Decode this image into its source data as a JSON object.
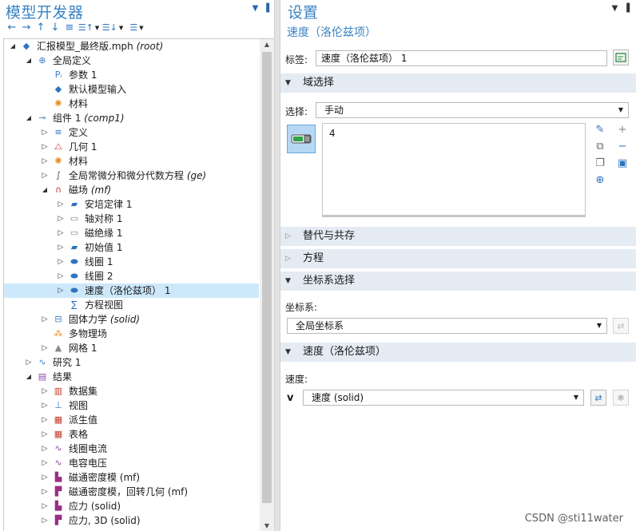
{
  "left_panel": {
    "title": "模型开发器",
    "toolbar_icons": [
      "arrow-left-icon",
      "arrow-right-icon",
      "arrow-up-icon",
      "arrow-down-icon",
      "collapse-icon",
      "sort-group-icon",
      "list-group-icon",
      "view-options-icon"
    ],
    "tree": [
      {
        "label": "汇报模型_最终版.mph",
        "tag": "(root)",
        "depth": 0,
        "expander": "open",
        "icon": "model-root-icon",
        "color": "#2e74c0"
      },
      {
        "label": "全局定义",
        "tag": "",
        "depth": 1,
        "expander": "open",
        "icon": "globe-icon",
        "color": "#3a7fc9"
      },
      {
        "label": "参数 1",
        "tag": "",
        "depth": 2,
        "expander": "",
        "icon": "parameters-icon",
        "color": "#3a7fc9"
      },
      {
        "label": "默认模型输入",
        "tag": "",
        "depth": 2,
        "expander": "",
        "icon": "model-input-icon",
        "color": "#2e74c0"
      },
      {
        "label": "材料",
        "tag": "",
        "depth": 2,
        "expander": "",
        "icon": "materials-icon",
        "color": "#e88a1a"
      },
      {
        "label": "组件 1",
        "tag": "(comp1)",
        "depth": 1,
        "expander": "open",
        "icon": "component-icon",
        "color": "#3a7fc9"
      },
      {
        "label": "定义",
        "tag": "",
        "depth": 2,
        "expander": "closed",
        "icon": "definitions-icon",
        "color": "#2e74c0"
      },
      {
        "label": "几何 1",
        "tag": "",
        "depth": 2,
        "expander": "closed",
        "icon": "geometry-icon",
        "color": "#c0392b"
      },
      {
        "label": "材料",
        "tag": "",
        "depth": 2,
        "expander": "closed",
        "icon": "materials-icon",
        "color": "#e88a1a"
      },
      {
        "label": "全局常微分和微分代数方程",
        "tag": "(ge)",
        "depth": 2,
        "expander": "closed",
        "icon": "ode-icon",
        "color": "#555"
      },
      {
        "label": "磁场",
        "tag": "(mf)",
        "depth": 2,
        "expander": "open",
        "icon": "magnet-icon",
        "color": "#c0392b"
      },
      {
        "label": "安培定律 1",
        "tag": "",
        "depth": 3,
        "expander": "closed",
        "icon": "domain-feature-icon",
        "color": "#2e74c0"
      },
      {
        "label": "轴对称 1",
        "tag": "",
        "depth": 3,
        "expander": "closed",
        "icon": "boundary-feature-icon",
        "color": "#888"
      },
      {
        "label": "磁绝缘 1",
        "tag": "",
        "depth": 3,
        "expander": "closed",
        "icon": "boundary-feature-icon",
        "color": "#888"
      },
      {
        "label": "初始值 1",
        "tag": "",
        "depth": 3,
        "expander": "closed",
        "icon": "domain-feature-icon",
        "color": "#2e74c0"
      },
      {
        "label": "线圈 1",
        "tag": "",
        "depth": 3,
        "expander": "closed",
        "icon": "domain-pill-icon",
        "color": "#2e74c0"
      },
      {
        "label": "线圈 2",
        "tag": "",
        "depth": 3,
        "expander": "closed",
        "icon": "domain-pill-icon",
        "color": "#2e74c0"
      },
      {
        "label": "速度（洛伦兹项） 1",
        "tag": "",
        "depth": 3,
        "expander": "closed",
        "icon": "domain-pill-icon",
        "color": "#2e74c0",
        "selected": true
      },
      {
        "label": "方程视图",
        "tag": "",
        "depth": 3,
        "expander": "",
        "icon": "equation-view-icon",
        "color": "#2e74c0"
      },
      {
        "label": "固体力学",
        "tag": "(solid)",
        "depth": 2,
        "expander": "closed",
        "icon": "solid-mechanics-icon",
        "color": "#3a7fc9"
      },
      {
        "label": "多物理场",
        "tag": "",
        "depth": 2,
        "expander": "",
        "icon": "multiphysics-icon",
        "color": "#e88a1a"
      },
      {
        "label": "网格 1",
        "tag": "",
        "depth": 2,
        "expander": "closed",
        "icon": "mesh-icon",
        "color": "#888"
      },
      {
        "label": "研究 1",
        "tag": "",
        "depth": 1,
        "expander": "closed",
        "icon": "study-icon",
        "color": "#3a7fc9"
      },
      {
        "label": "结果",
        "tag": "",
        "depth": 1,
        "expander": "open",
        "icon": "results-icon",
        "color": "#8e44ad"
      },
      {
        "label": "数据集",
        "tag": "",
        "depth": 2,
        "expander": "closed",
        "icon": "dataset-icon",
        "color": "#c0392b"
      },
      {
        "label": "视图",
        "tag": "",
        "depth": 2,
        "expander": "closed",
        "icon": "views-icon",
        "color": "#2e74c0"
      },
      {
        "label": "派生值",
        "tag": "",
        "depth": 2,
        "expander": "closed",
        "icon": "derived-values-icon",
        "color": "#c0392b"
      },
      {
        "label": "表格",
        "tag": "",
        "depth": 2,
        "expander": "closed",
        "icon": "table-icon",
        "color": "#c0392b"
      },
      {
        "label": "线圈电流",
        "tag": "",
        "depth": 2,
        "expander": "closed",
        "icon": "plot-1d-icon",
        "color": "#8e44ad"
      },
      {
        "label": "电容电压",
        "tag": "",
        "depth": 2,
        "expander": "closed",
        "icon": "plot-1d-icon",
        "color": "#8e44ad"
      },
      {
        "label": "磁通密度模 (mf)",
        "tag": "",
        "depth": 2,
        "expander": "closed",
        "icon": "plot-2d-icon",
        "color": "#9b2d86"
      },
      {
        "label": "磁通密度模，回转几何 (mf)",
        "tag": "",
        "depth": 2,
        "expander": "closed",
        "icon": "plot-3d-icon",
        "color": "#9b2d86"
      },
      {
        "label": "应力 (solid)",
        "tag": "",
        "depth": 2,
        "expander": "closed",
        "icon": "plot-2d-icon",
        "color": "#9b2d86"
      },
      {
        "label": "应力, 3D (solid)",
        "tag": "",
        "depth": 2,
        "expander": "closed",
        "icon": "plot-3d-icon",
        "color": "#9b2d86"
      }
    ]
  },
  "right_panel": {
    "title": "设置",
    "subtitle": "速度（洛伦兹项）",
    "label_key": "标签:",
    "label_value": "速度（洛伦兹项） 1",
    "sections": {
      "domain_selection": "域选择",
      "override": "替代与共存",
      "equation": "方程",
      "coord_selection": "坐标系选择",
      "velocity": "速度（洛伦兹项）"
    },
    "selection_key": "选择:",
    "selection_value": "手动",
    "selection_list": [
      "4"
    ],
    "coord_key": "坐标系:",
    "coord_value": "全局坐标系",
    "velocity_key": "速度:",
    "velocity_symbol": "v",
    "velocity_value": "速度 (solid)"
  },
  "watermark": "CSDN @sti11water",
  "colors": {
    "title_blue": "#3b83c4",
    "selection_highlight": "#cde8fb",
    "section_header": "#e4ebf3"
  }
}
